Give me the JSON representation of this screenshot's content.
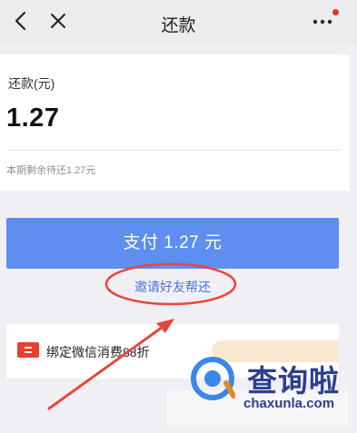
{
  "navbar": {
    "title": "还款"
  },
  "repayment": {
    "amount_label": "还款(元)",
    "amount": "1.27",
    "remaining_text": "本期剩余待还1.27元"
  },
  "actions": {
    "pay_button": "支付 1.27 元",
    "invite_link": "邀请好友帮还"
  },
  "promo": {
    "text": "绑定微信消费88折"
  },
  "watermark": {
    "brand": "查询啦",
    "url": "chaxunla.com"
  },
  "colors": {
    "primary": "#5d8ef0",
    "link": "#4a78d6",
    "annotation": "#e5483b",
    "watermark": "#2d3f8e"
  }
}
